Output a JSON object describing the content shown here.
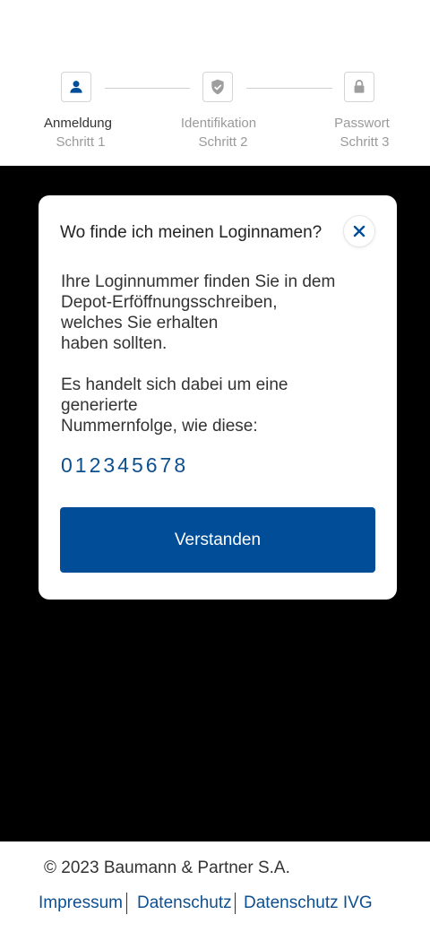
{
  "stepper": {
    "steps": [
      {
        "title": "Anmeldung",
        "subtitle": "Schritt 1",
        "icon": "user-icon",
        "state": "active"
      },
      {
        "title": "Identifikation",
        "subtitle": "Schritt 2",
        "icon": "shield-check-icon",
        "state": "inactive"
      },
      {
        "title": "Passwort",
        "subtitle": "Schritt 3",
        "icon": "lock-icon",
        "state": "inactive"
      }
    ]
  },
  "modal": {
    "title": "Wo finde ich meinen Loginnamen?",
    "paragraph1_lines": [
      "Ihre Loginnummer finden Sie in dem",
      "Depot-Erföffnungsschreiben,",
      "welches Sie erhalten",
      "haben sollten."
    ],
    "paragraph2_lines": [
      "Es handelt sich dabei um eine",
      "generierte",
      "Nummernfolge, wie diese:"
    ],
    "example_number": "012345678",
    "confirm_label": "Verstanden",
    "close_icon": "close-icon"
  },
  "footer": {
    "copyright": "© 2023 Baumann & Partner S.A.",
    "links": [
      "Impressum",
      "Datenschutz",
      "Datenschutz IVG"
    ]
  },
  "colors": {
    "brand_blue": "#014d97",
    "link_blue": "#0e4f8f",
    "overlay": "#000000",
    "muted_text": "#9a9a9a"
  }
}
